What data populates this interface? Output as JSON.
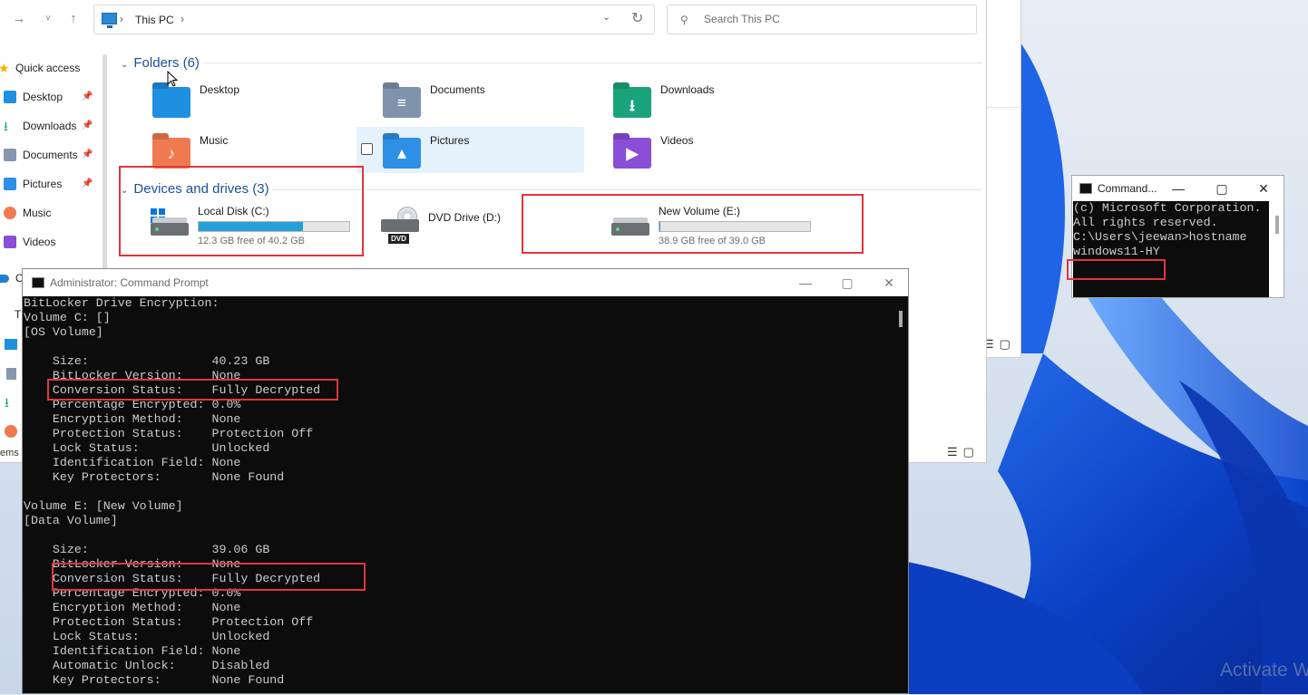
{
  "explorer": {
    "breadcrumb": "This PC",
    "search_placeholder": "Search This PC",
    "sidebar": [
      {
        "label": "Quick access",
        "icon": "star-icon",
        "pinned": false
      },
      {
        "label": "Desktop",
        "icon": "desktop-folder-icon",
        "pinned": true
      },
      {
        "label": "Downloads",
        "icon": "download-arrow-icon",
        "pinned": true
      },
      {
        "label": "Documents",
        "icon": "document-icon",
        "pinned": true
      },
      {
        "label": "Pictures",
        "icon": "picture-icon",
        "pinned": true
      },
      {
        "label": "Music",
        "icon": "music-icon",
        "pinned": false
      },
      {
        "label": "Videos",
        "icon": "video-icon",
        "pinned": false
      },
      {
        "label": "O",
        "icon": "onedrive-cloud-icon",
        "pinned": false
      },
      {
        "label": "T",
        "icon": "this-pc-icon",
        "pinned": false
      }
    ],
    "sidebar_cut_label": "ems",
    "folders_header": "Folders (6)",
    "folders": [
      {
        "label": "Desktop",
        "color": "#1f8fe0",
        "glyph": ""
      },
      {
        "label": "Documents",
        "color": "#7f93ad",
        "glyph": "≡"
      },
      {
        "label": "Downloads",
        "color": "#1aa37a",
        "glyph": "⭳"
      },
      {
        "label": "Music",
        "color": "#f07a50",
        "glyph": "♪"
      },
      {
        "label": "Pictures",
        "color": "#2e8fe6",
        "glyph": "▲"
      },
      {
        "label": "Videos",
        "color": "#8a4fd6",
        "glyph": "▶"
      }
    ],
    "devices_header": "Devices and drives (3)",
    "drives": [
      {
        "label": "Local Disk (C:)",
        "free": "12.3 GB free of 40.2 GB",
        "used_fraction": 0.69
      },
      {
        "label": "DVD Drive (D:)",
        "badge": "DVD"
      },
      {
        "label": "New Volume (E:)",
        "free": "38.9 GB free of 39.0 GB",
        "used_fraction": 0.003
      }
    ]
  },
  "admin_cmd": {
    "title": "Administrator: Command Prompt",
    "lines": [
      "BitLocker Drive Encryption:",
      "Volume C: []",
      "[OS Volume]",
      "",
      "    Size:                 40.23 GB",
      "    BitLocker Version:    None",
      "    Conversion Status:    Fully Decrypted",
      "    Percentage Encrypted: 0.0%",
      "    Encryption Method:    None",
      "    Protection Status:    Protection Off",
      "    Lock Status:          Unlocked",
      "    Identification Field: None",
      "    Key Protectors:       None Found",
      "",
      "Volume E: [New Volume]",
      "[Data Volume]",
      "",
      "    Size:                 39.06 GB",
      "    BitLocker Version:    None",
      "    Conversion Status:    Fully Decrypted",
      "    Percentage Encrypted: 0.0%",
      "    Encryption Method:    None",
      "    Protection Status:    Protection Off",
      "    Lock Status:          Unlocked",
      "    Identification Field: None",
      "    Automatic Unlock:     Disabled",
      "    Key Protectors:       None Found"
    ]
  },
  "small_cmd": {
    "title": "Command...",
    "lines": [
      "(c) Microsoft Corporation.",
      "All rights reserved.",
      "",
      "C:\\Users\\jeewan>hostname",
      "windows11-HY"
    ]
  },
  "watermark": "Activate W",
  "colors": {
    "highlight_box": "#e0363a",
    "wallpaper_blue": "#0a4fd6",
    "console_bg": "#0c0c0c"
  }
}
